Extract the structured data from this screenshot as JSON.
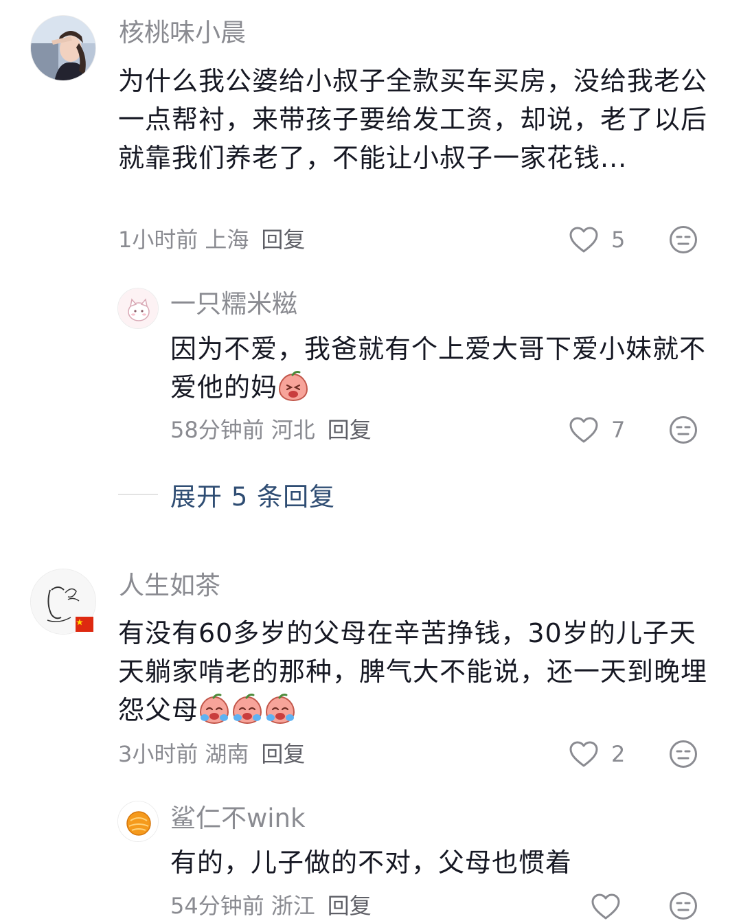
{
  "comments": [
    {
      "username": "核桃味小晨",
      "text": "为什么我公婆给小叔子全款买车买房，没给我老公一点帮衬，来带孩子要给发工资，却说，老了以后就靠我们养老了，不能让小叔子一家花钱...",
      "time": "1小时前",
      "location": "上海",
      "reply_label": "回复",
      "likes": "5",
      "replies": [
        {
          "username": "一只糯米糍",
          "text": "因为不爱，我爸就有个上爱大哥下爱小妹就不爱他的妈",
          "time": "58分钟前",
          "location": "河北",
          "reply_label": "回复",
          "likes": "7"
        }
      ],
      "expand_label": "展开 5 条回复"
    },
    {
      "username": "人生如茶",
      "text": "有没有60多岁的父母在辛苦挣钱，30岁的儿子天天躺家啃老的那种，脾气大不能说，还一天到晚埋怨父母",
      "time": "3小时前",
      "location": "湖南",
      "reply_label": "回复",
      "likes": "2",
      "replies": [
        {
          "username": "鲨仁不wink",
          "text": "有的，儿子做的不对，父母也惯着",
          "time": "54分钟前",
          "location": "浙江",
          "reply_label": "回复",
          "likes": ""
        }
      ]
    }
  ],
  "colors": {
    "text": "#161823",
    "meta": "#8a8b91",
    "expand": "#2f4d73"
  }
}
